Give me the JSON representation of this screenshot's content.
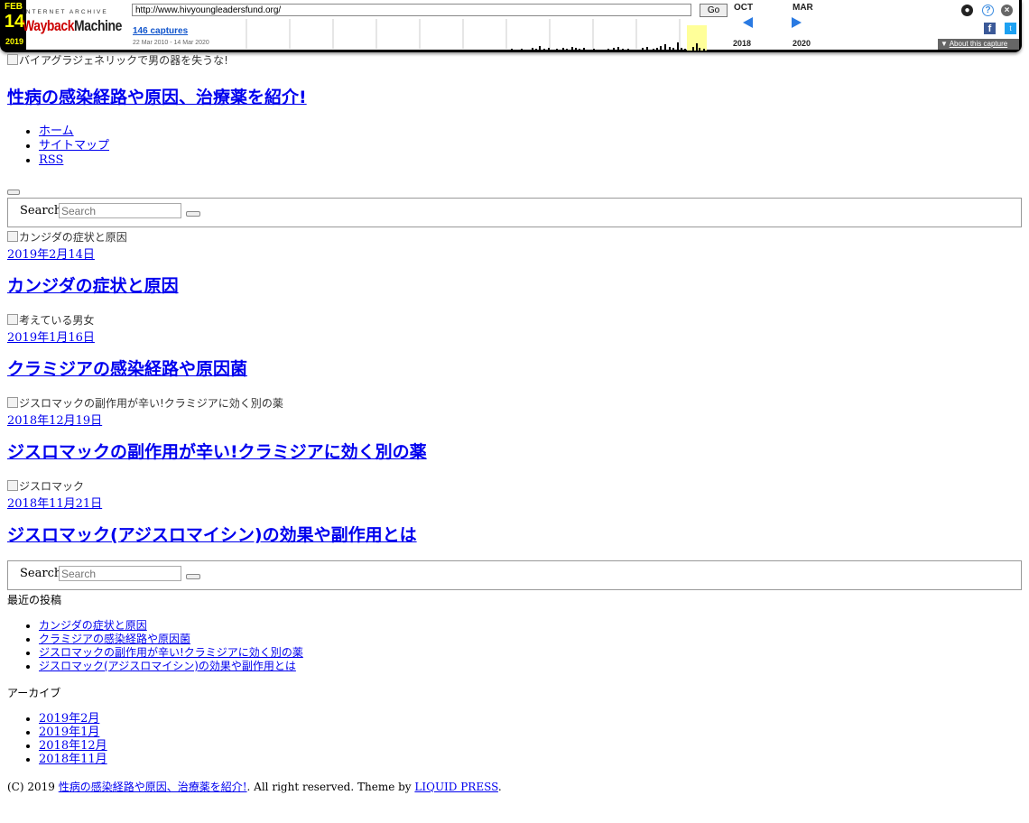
{
  "wayback": {
    "logo_top": "INTERNET ARCHIVE",
    "logo_main": "Wayback",
    "logo_main2": "Machine",
    "url": "http://www.hivyoungleadersfund.org/",
    "go_label": "Go",
    "captures": "146 captures",
    "date_range": "22 Mar 2010 - 14 Mar 2020",
    "prev_month": "OCT",
    "cur_month": "FEB",
    "cur_day": "14",
    "next_month": "MAR",
    "prev_year": "2018",
    "cur_year": "2019",
    "next_year": "2020",
    "about": "About this capture"
  },
  "page": {
    "header_img_alt": "バイアグラジェネリックで男の器を失うな!",
    "site_title": "性病の感染経路や原因、治療薬を紹介!",
    "nav": [
      "ホーム",
      "サイトマップ",
      "RSS"
    ],
    "search_label": "Search",
    "search_placeholder": "Search",
    "posts": [
      {
        "img_alt": "カンジダの症状と原因",
        "date": "2019年2月14日",
        "title": "カンジダの症状と原因"
      },
      {
        "img_alt": "考えている男女",
        "date": "2019年1月16日",
        "title": "クラミジアの感染経路や原因菌"
      },
      {
        "img_alt": "ジスロマックの副作用が辛い!クラミジアに効く別の薬",
        "date": "2018年12月19日",
        "title": "ジスロマックの副作用が辛い!クラミジアに効く別の薬"
      },
      {
        "img_alt": "ジスロマック",
        "date": "2018年11月21日",
        "title": "ジスロマック(アジスロマイシン)の効果や副作用とは"
      }
    ],
    "recent_title": "最近の投稿",
    "recent": [
      "カンジダの症状と原因",
      "クラミジアの感染経路や原因菌",
      "ジスロマックの副作用が辛い!クラミジアに効く別の薬",
      "ジスロマック(アジスロマイシン)の効果や副作用とは"
    ],
    "archive_title": "アーカイブ",
    "archives": [
      "2019年2月",
      "2019年1月",
      "2018年12月",
      "2018年11月"
    ],
    "footer_prefix": "(C) 2019 ",
    "footer_site": "性病の感染経路や原因、治療薬を紹介!",
    "footer_mid": ". All right reserved. Theme by ",
    "footer_theme": "LIQUID PRESS",
    "footer_end": "."
  }
}
